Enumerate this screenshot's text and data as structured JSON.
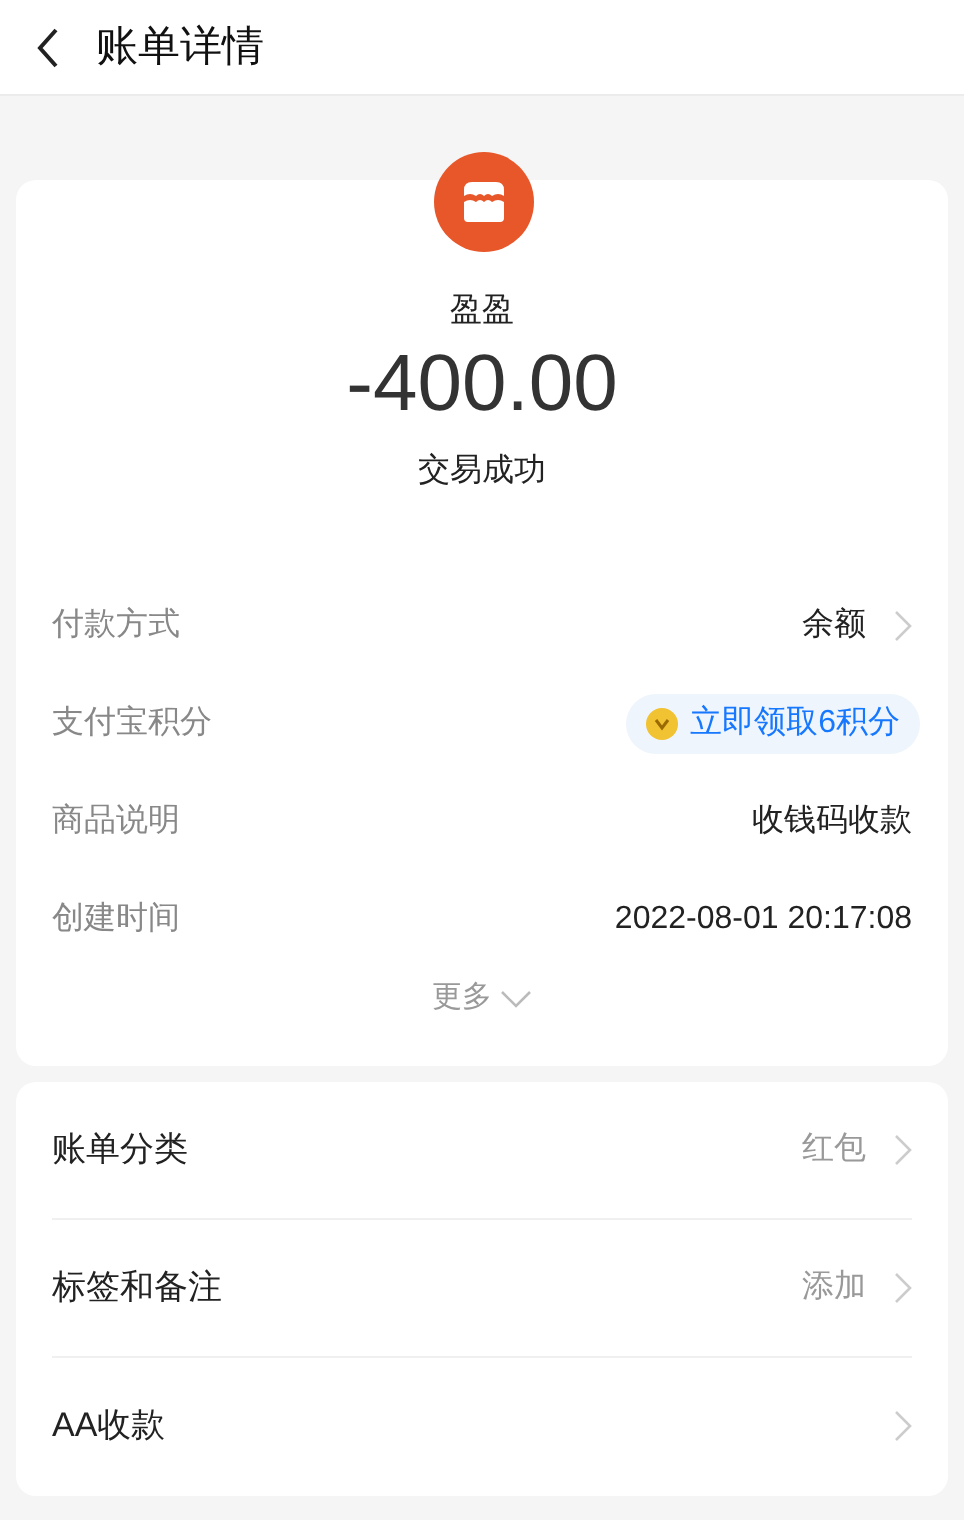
{
  "header": {
    "title": "账单详情"
  },
  "summary": {
    "payee": "盈盈",
    "amount": "-400.00",
    "status": "交易成功"
  },
  "details": [
    {
      "kind": "link",
      "label": "付款方式",
      "value": "余额"
    },
    {
      "kind": "badge",
      "label": "支付宝积分",
      "value": "立即领取6积分"
    },
    {
      "kind": "plain",
      "label": "商品说明",
      "value": "收钱码收款"
    },
    {
      "kind": "plain",
      "label": "创建时间",
      "value": "2022-08-01 20:17:08"
    }
  ],
  "more": {
    "label": "更多"
  },
  "actions": [
    {
      "label": "账单分类",
      "value": "红包"
    },
    {
      "label": "标签和备注",
      "value": "添加"
    },
    {
      "label": "AA收款"
    }
  ]
}
